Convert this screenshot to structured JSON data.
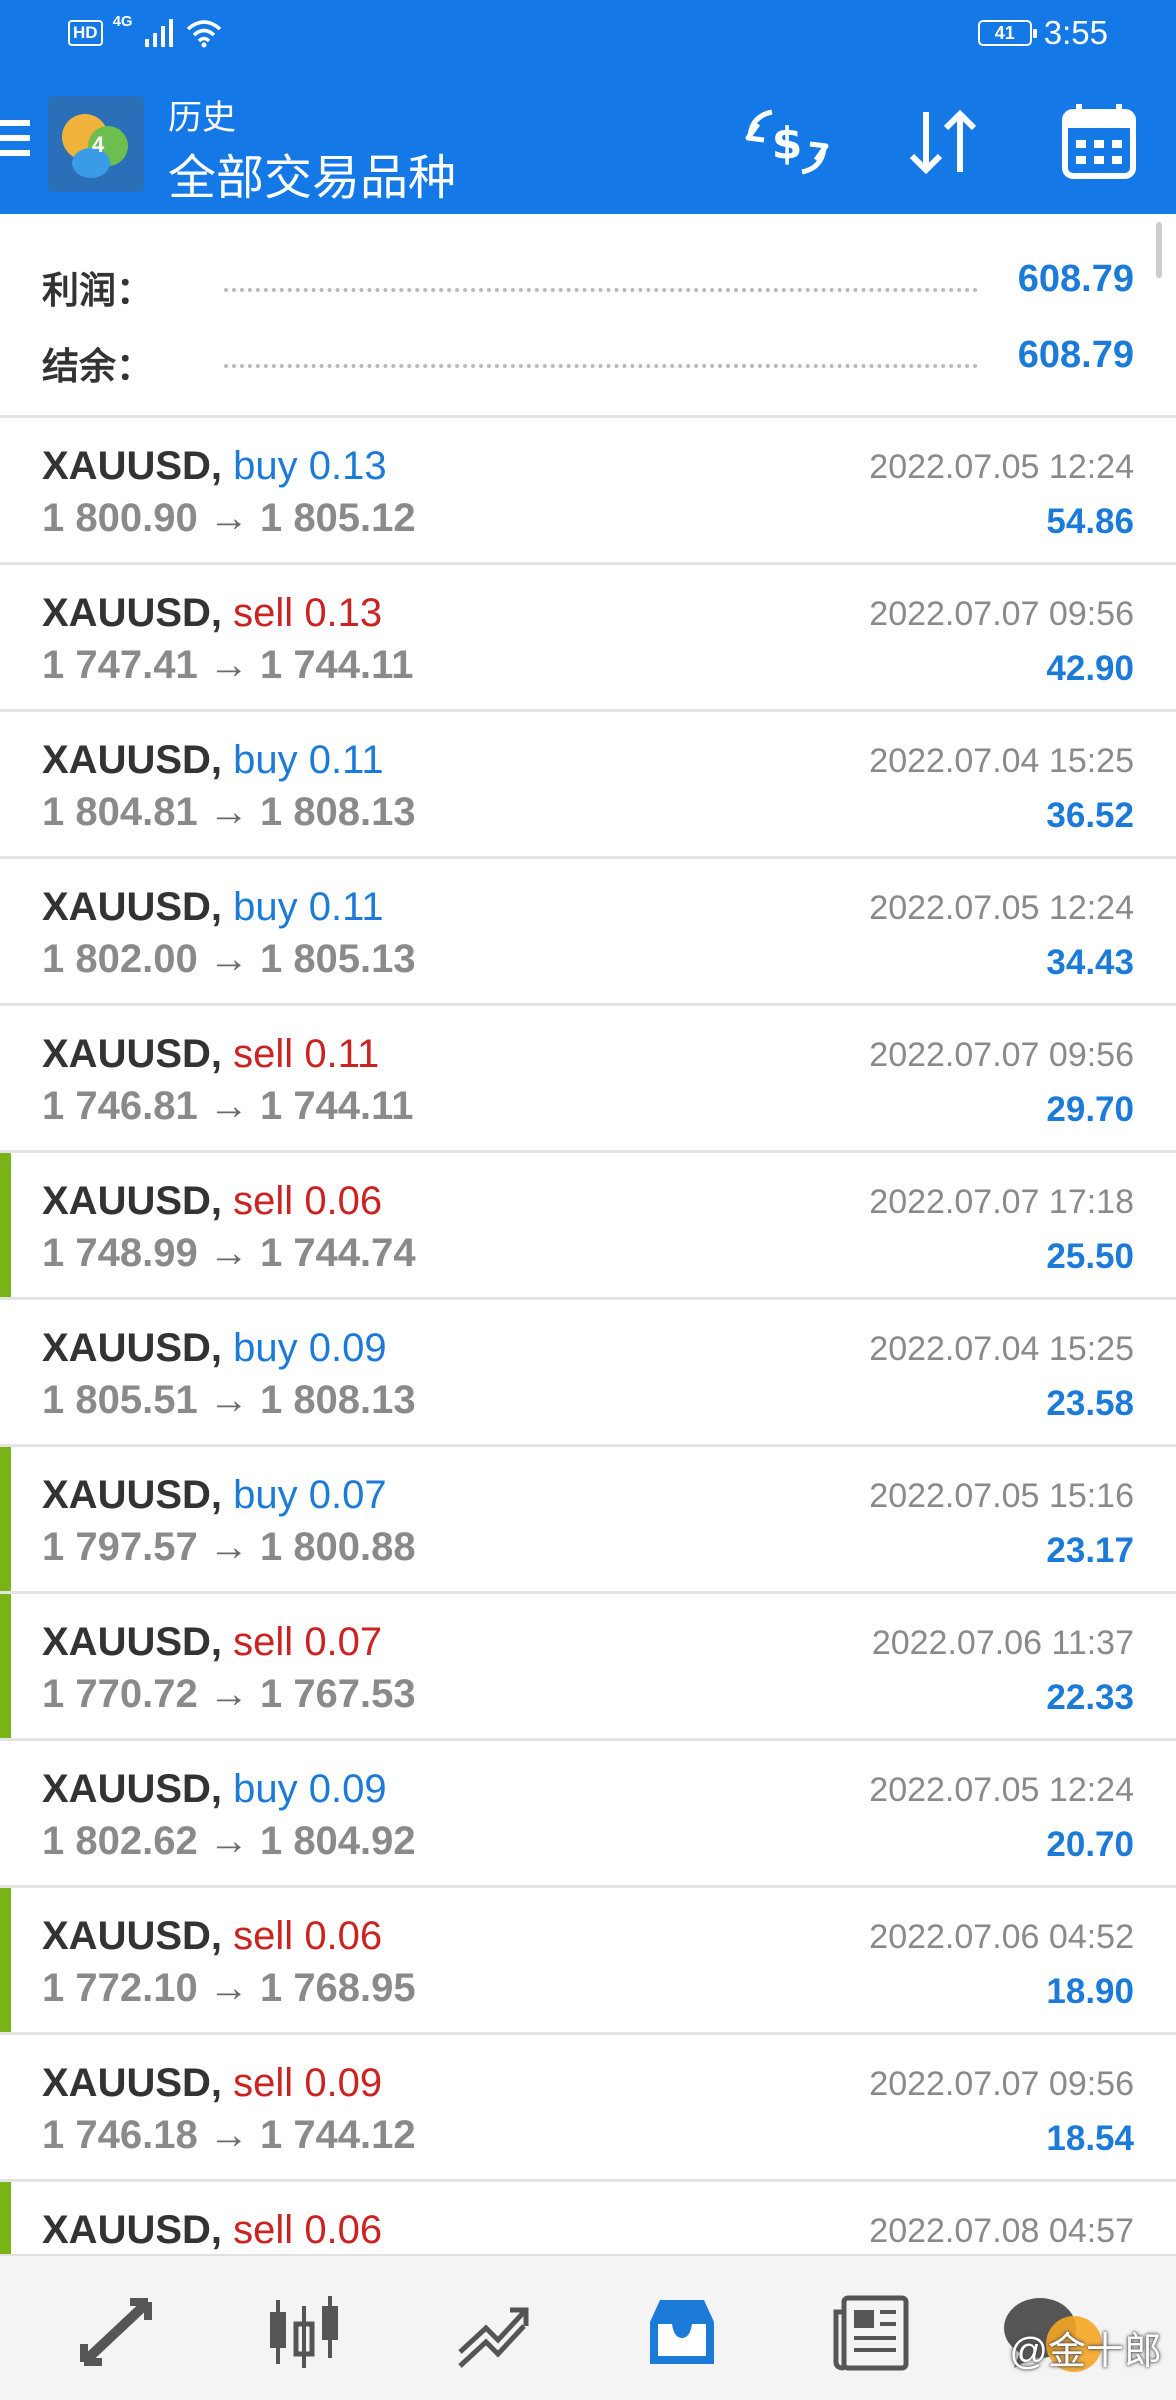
{
  "status_bar": {
    "left_badge": "HD",
    "network": "4G",
    "battery": "41",
    "time": "3:55"
  },
  "app_bar": {
    "title_small": "历史",
    "title_big": "全部交易品种",
    "icons": [
      "menu-icon",
      "app-logo",
      "currency-exchange-icon",
      "sort-icon",
      "calendar-icon"
    ]
  },
  "summary": {
    "profit_label": "利润：",
    "profit_value": "608.79",
    "balance_label": "结余：",
    "balance_value": "608.79"
  },
  "trades": [
    {
      "symbol": "XAUUSD,",
      "side": "buy",
      "volume": "0.13",
      "open": "1 800.90",
      "arrow": "→",
      "close": "1 805.12",
      "time": "2022.07.05 12:24",
      "profit": "54.86",
      "marked": false
    },
    {
      "symbol": "XAUUSD,",
      "side": "sell",
      "volume": "0.13",
      "open": "1 747.41",
      "arrow": "→",
      "close": "1 744.11",
      "time": "2022.07.07 09:56",
      "profit": "42.90",
      "marked": false
    },
    {
      "symbol": "XAUUSD,",
      "side": "buy",
      "volume": "0.11",
      "open": "1 804.81",
      "arrow": "→",
      "close": "1 808.13",
      "time": "2022.07.04 15:25",
      "profit": "36.52",
      "marked": false
    },
    {
      "symbol": "XAUUSD,",
      "side": "buy",
      "volume": "0.11",
      "open": "1 802.00",
      "arrow": "→",
      "close": "1 805.13",
      "time": "2022.07.05 12:24",
      "profit": "34.43",
      "marked": false
    },
    {
      "symbol": "XAUUSD,",
      "side": "sell",
      "volume": "0.11",
      "open": "1 746.81",
      "arrow": "→",
      "close": "1 744.11",
      "time": "2022.07.07 09:56",
      "profit": "29.70",
      "marked": false
    },
    {
      "symbol": "XAUUSD,",
      "side": "sell",
      "volume": "0.06",
      "open": "1 748.99",
      "arrow": "→",
      "close": "1 744.74",
      "time": "2022.07.07 17:18",
      "profit": "25.50",
      "marked": true
    },
    {
      "symbol": "XAUUSD,",
      "side": "buy",
      "volume": "0.09",
      "open": "1 805.51",
      "arrow": "→",
      "close": "1 808.13",
      "time": "2022.07.04 15:25",
      "profit": "23.58",
      "marked": false
    },
    {
      "symbol": "XAUUSD,",
      "side": "buy",
      "volume": "0.07",
      "open": "1 797.57",
      "arrow": "→",
      "close": "1 800.88",
      "time": "2022.07.05 15:16",
      "profit": "23.17",
      "marked": true
    },
    {
      "symbol": "XAUUSD,",
      "side": "sell",
      "volume": "0.07",
      "open": "1 770.72",
      "arrow": "→",
      "close": "1 767.53",
      "time": "2022.07.06 11:37",
      "profit": "22.33",
      "marked": true
    },
    {
      "symbol": "XAUUSD,",
      "side": "buy",
      "volume": "0.09",
      "open": "1 802.62",
      "arrow": "→",
      "close": "1 804.92",
      "time": "2022.07.05 12:24",
      "profit": "20.70",
      "marked": false
    },
    {
      "symbol": "XAUUSD,",
      "side": "sell",
      "volume": "0.06",
      "open": "1 772.10",
      "arrow": "→",
      "close": "1 768.95",
      "time": "2022.07.06 04:52",
      "profit": "18.90",
      "marked": true
    },
    {
      "symbol": "XAUUSD,",
      "side": "sell",
      "volume": "0.09",
      "open": "1 746.18",
      "arrow": "→",
      "close": "1 744.12",
      "time": "2022.07.07 09:56",
      "profit": "18.54",
      "marked": false
    },
    {
      "symbol": "XAUUSD,",
      "side": "sell",
      "volume": "0.06",
      "open": "",
      "arrow": "",
      "close": "",
      "time": "2022.07.08 04:57",
      "profit": "",
      "marked": true
    }
  ],
  "bottom_nav": {
    "items": [
      "quotes-icon",
      "chart-icon",
      "trade-icon",
      "history-icon",
      "news-icon",
      "chat-icon"
    ],
    "active": "history-icon",
    "watermark": "@金十郎"
  },
  "colors": {
    "primary": "#1479e6",
    "buy": "#1c7ad9",
    "sell": "#cc2222",
    "marker": "#7ab317",
    "text_dark": "#333333",
    "text_grey": "#8a8a8a"
  }
}
